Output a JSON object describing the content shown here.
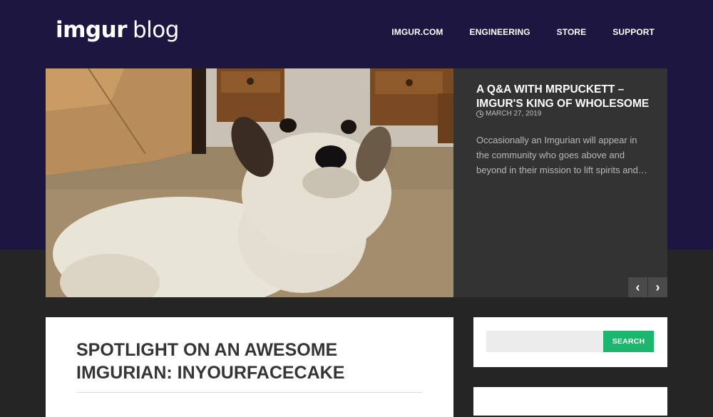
{
  "logo": {
    "bold": "imgur",
    "light": "blog"
  },
  "nav": {
    "items": [
      "IMGUR.COM",
      "ENGINEERING",
      "STORE",
      "SUPPORT"
    ]
  },
  "featured": {
    "title": "A Q&A WITH MRPUCKETT – IMGUR'S KING OF WHOLESOME",
    "date": "MARCH 27, 2019",
    "excerpt": "Occasionally an Imgurian will appear in the community who goes above and beyond in their mission to lift spirits and…",
    "prev_label": "‹",
    "next_label": "›"
  },
  "article": {
    "title": "SPOTLIGHT ON AN AWESOME IMGURIAN: INYOURFACECAKE"
  },
  "sidebar": {
    "search_placeholder": "",
    "search_button": "SEARCH"
  },
  "colors": {
    "header_bg": "#1c1641",
    "page_bg": "#252525",
    "panel_bg": "#333333",
    "accent_green": "#1bb76e"
  }
}
